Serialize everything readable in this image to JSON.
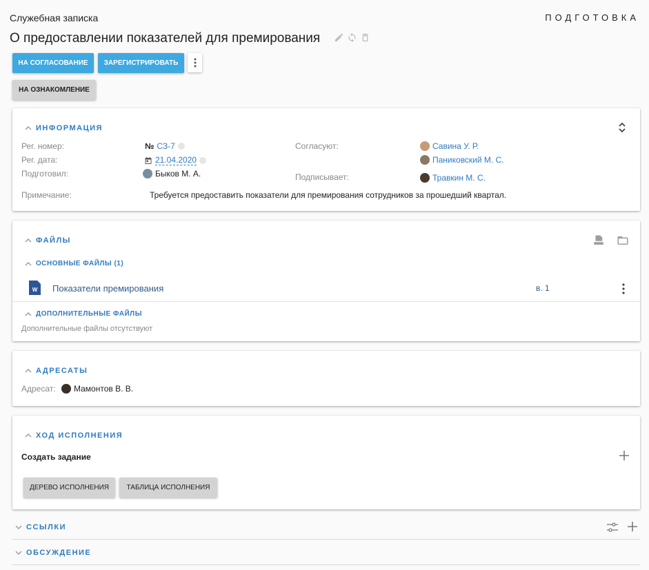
{
  "header": {
    "doc_type": "Служебная записка",
    "status": "ПОДГОТОВКА",
    "title": "О предоставлении показателей для премирования"
  },
  "actions": {
    "send_approval": "НА СОГЛАСОВАНИЕ",
    "register": "ЗАРЕГИСТРИРОВАТЬ",
    "to_review": "НА ОЗНАКОМЛЕНИЕ"
  },
  "info": {
    "title": "ИНФОРМАЦИЯ",
    "reg_number_label": "Рег. номер:",
    "reg_number_prefix": "№",
    "reg_number": "СЗ-7",
    "reg_date_label": "Рег. дата:",
    "reg_date": "21.04.2020",
    "prepared_label": "Подготовил:",
    "prepared_by": "Быков М. А.",
    "approvers_label": "Согласуют:",
    "approvers": [
      "Савина У. Р.",
      "Паниковский М. С."
    ],
    "signer_label": "Подписывает:",
    "signer": "Травкин М. С.",
    "note_label": "Примечание:",
    "note": "Требуется предоставить показатели для премирования сотрудников за прошедший квартал."
  },
  "files": {
    "title": "ФАЙЛЫ",
    "main_title": "ОСНОВНЫЕ ФАЙЛЫ (1)",
    "file_name": "Показатели премирования",
    "file_version": "в. 1",
    "extra_title": "ДОПОЛНИТЕЛЬНЫЕ ФАЙЛЫ",
    "extra_empty": "Дополнительные файлы отсутствуют"
  },
  "addressees": {
    "title": "АДРЕСАТЫ",
    "label": "Адресат:",
    "name": "Мамонтов В. В."
  },
  "execution": {
    "title": "ХОД ИСПОЛНЕНИЯ",
    "create_task": "Создать задание",
    "tree": "ДЕРЕВО ИСПОЛНЕНИЯ",
    "table": "ТАБЛИЦА ИСПОЛНЕНИЯ"
  },
  "links": {
    "title": "ССЫЛКИ"
  },
  "discussion": {
    "title": "ОБСУЖДЕНИЕ"
  },
  "colors": {
    "accent": "#3ea8e0",
    "link": "#2f7bc0",
    "word": "#2b5797"
  }
}
